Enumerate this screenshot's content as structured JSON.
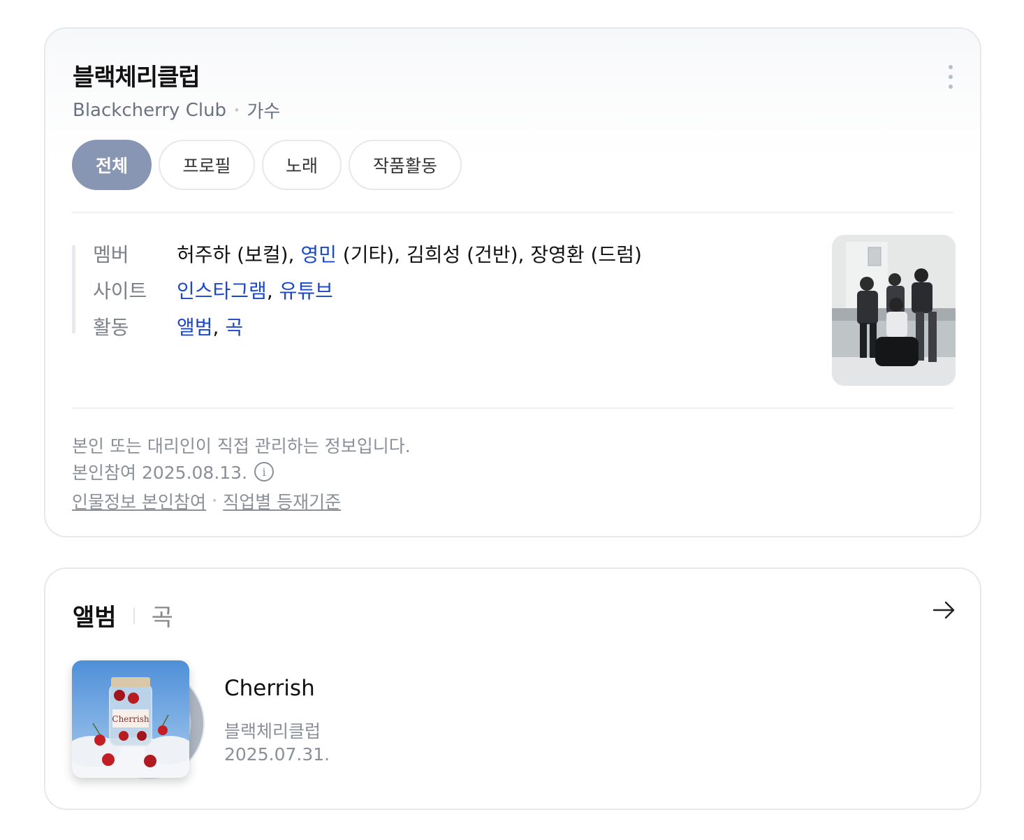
{
  "profile": {
    "name": "블랙체리클럽",
    "name_en": "Blackcherry Club",
    "occupation": "가수",
    "more_icon": "more-vertical-icon",
    "tabs": [
      {
        "label": "전체",
        "active": true
      },
      {
        "label": "프로필",
        "active": false
      },
      {
        "label": "노래",
        "active": false
      },
      {
        "label": "작품활동",
        "active": false
      }
    ],
    "info": {
      "member_label": "멤버",
      "members": {
        "m1": "허주하 (보컬), ",
        "m2_link": "영민",
        "m2_role": " (기타), ",
        "m3": "김희성 (건반), ",
        "m4": "장영환 (드럼)"
      },
      "site_label": "사이트",
      "sites": {
        "instagram": "인스타그램",
        "comma": ", ",
        "youtube": "유튜브"
      },
      "activity_label": "활동",
      "activities": {
        "album": "앨범",
        "comma": ", ",
        "song": "곡"
      }
    },
    "footnote": {
      "managed": "본인 또는 대리인이 직접 관리하는 정보입니다.",
      "participation": "본인참여 2025.08.13.",
      "info_icon": "info-circle-icon",
      "link1": "인물정보 본인참여",
      "link2": "직업별 등재기준"
    },
    "colors": {
      "active_tab": "#8996b3",
      "link": "#1b47c9"
    }
  },
  "albums": {
    "tab_album": "앨범",
    "tab_song": "곡",
    "arrow_icon": "arrow-right-icon",
    "items": [
      {
        "title": "Cherrish",
        "artist": "블랙체리클럽",
        "date": "2025.07.31.",
        "cover_text": "Cherrish"
      }
    ]
  }
}
